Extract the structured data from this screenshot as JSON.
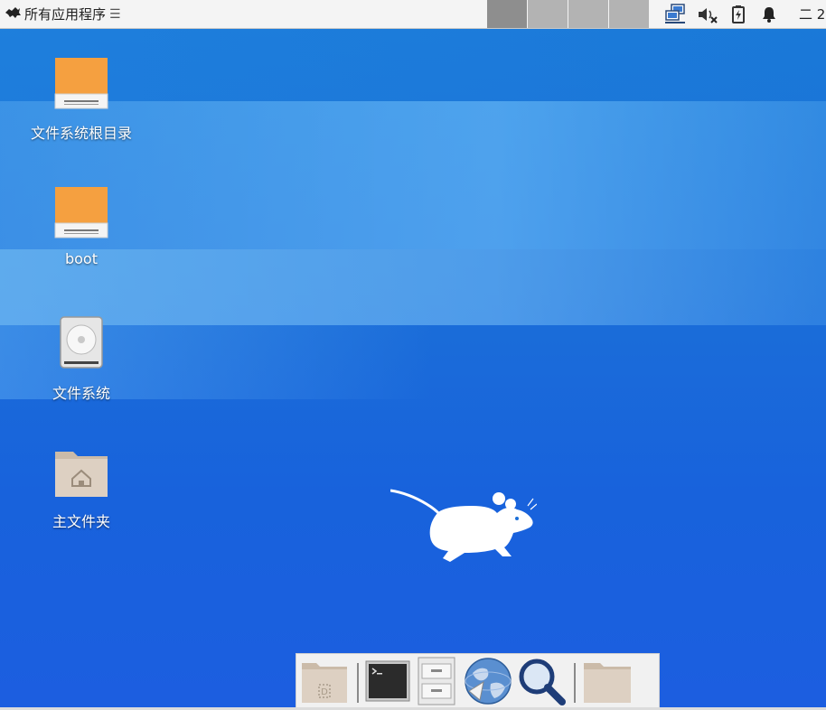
{
  "top_panel": {
    "menu_label": "所有应用程序",
    "menu_separator": "☰",
    "clock_text": "二 2",
    "icons": [
      "xfce-mouse-icon",
      "network-icon",
      "volume-muted-icon",
      "battery-charging-icon",
      "notification-bell-icon"
    ],
    "workspaces": 4
  },
  "desktop": {
    "icons": [
      {
        "label": "文件系统根目录",
        "icon": "drive-orange-icon"
      },
      {
        "label": "boot",
        "icon": "drive-orange-icon"
      },
      {
        "label": "文件系统",
        "icon": "hard-disk-icon"
      },
      {
        "label": "主文件夹",
        "icon": "home-folder-icon"
      }
    ],
    "logo": "xfce-mouse-logo"
  },
  "dock": {
    "items": [
      "show-desktop-icon",
      "terminal-icon",
      "file-manager-icon",
      "web-browser-icon",
      "search-icon",
      "folder-icon"
    ]
  },
  "colors": {
    "desktop_blue": "#1a6fd8",
    "panel_bg": "#f4f4f4",
    "drive_orange": "#f5a040"
  }
}
